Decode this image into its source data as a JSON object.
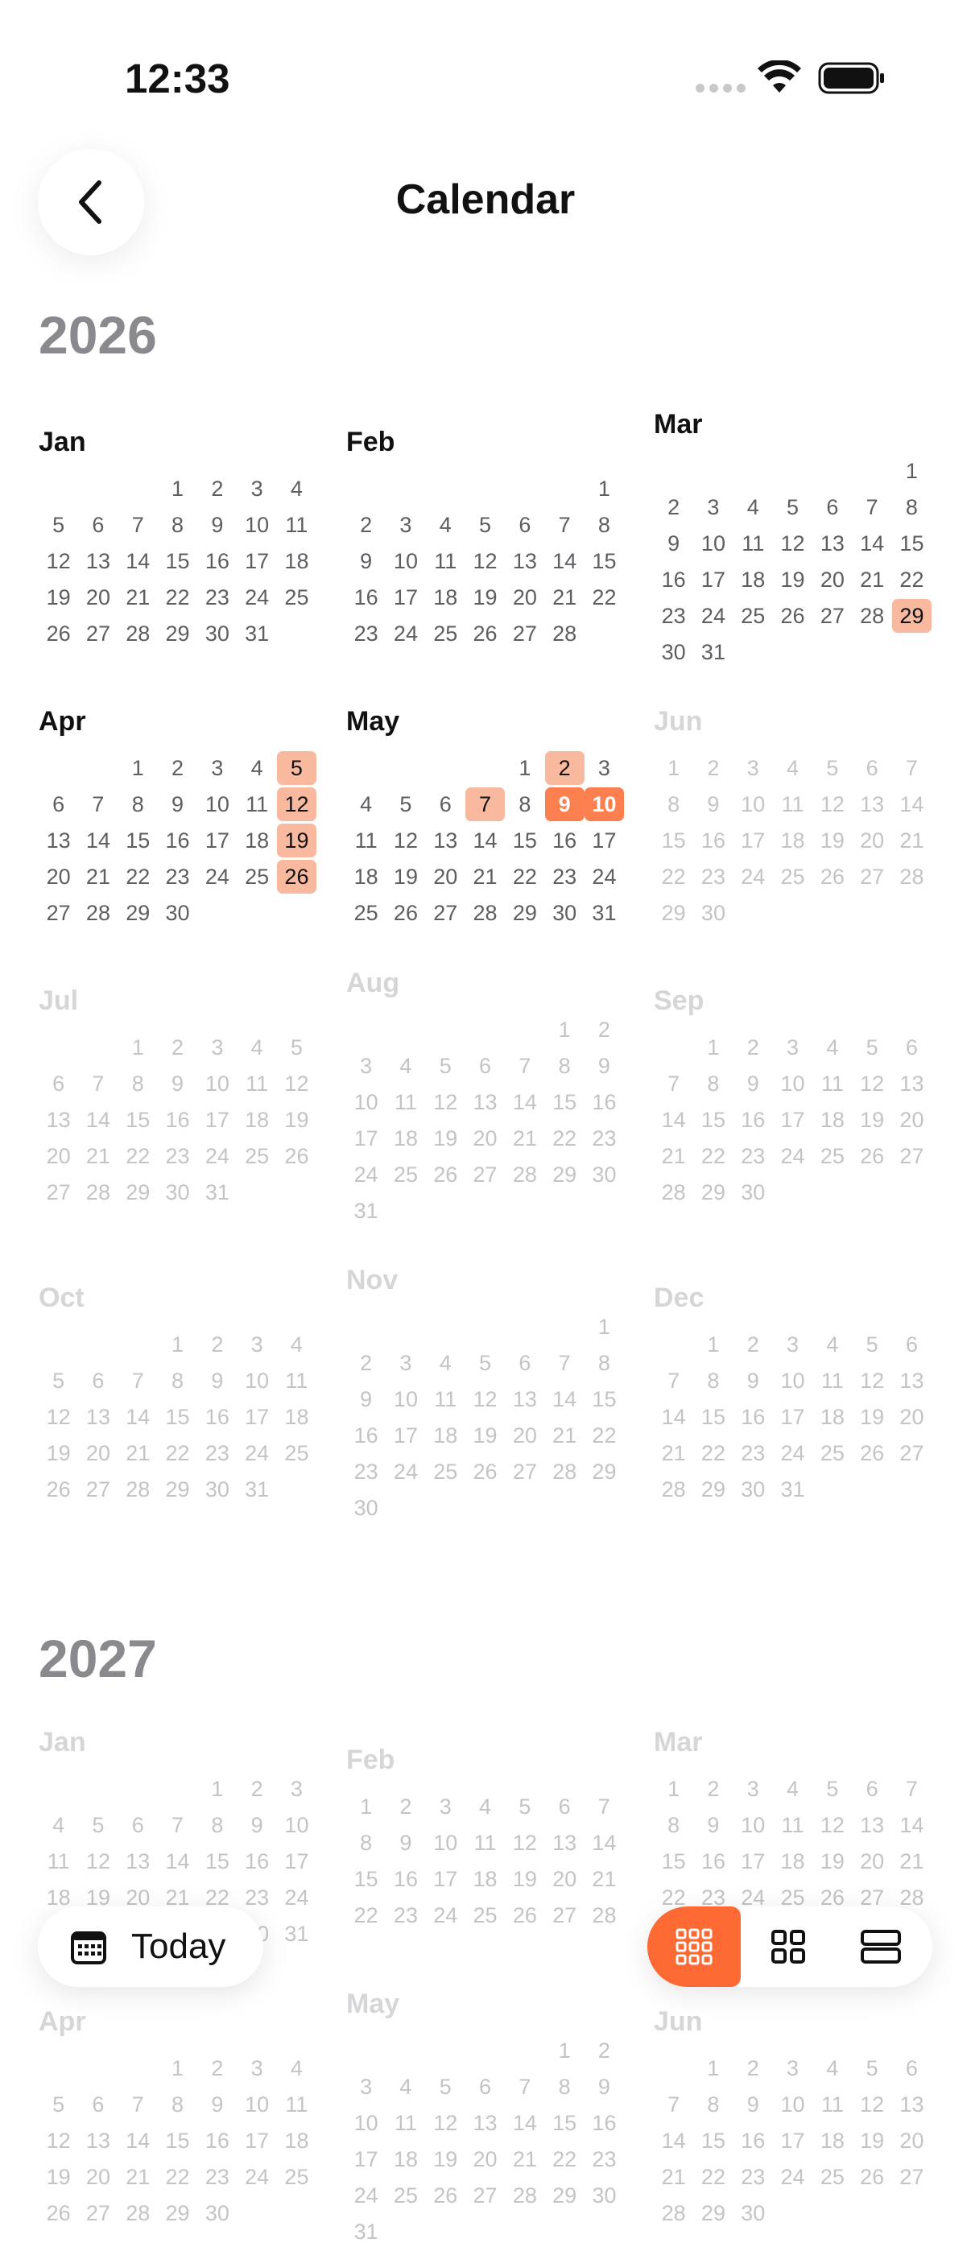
{
  "status_bar": {
    "time": "12:33"
  },
  "header": {
    "title": "Calendar"
  },
  "years": [
    {
      "label": "2026",
      "months": [
        {
          "name": "Jan",
          "start": 3,
          "days": 31,
          "dim": false
        },
        {
          "name": "Feb",
          "start": 6,
          "days": 28,
          "dim": false
        },
        {
          "name": "Mar",
          "start": 6,
          "days": 31,
          "dim": false
        },
        {
          "name": "Apr",
          "start": 2,
          "days": 30,
          "dim": false
        },
        {
          "name": "May",
          "start": 4,
          "days": 31,
          "dim": false
        },
        {
          "name": "Jun",
          "start": 0,
          "days": 30,
          "dim": true
        },
        {
          "name": "Jul",
          "start": 2,
          "days": 31,
          "dim": true
        },
        {
          "name": "Aug",
          "start": 5,
          "days": 31,
          "dim": true
        },
        {
          "name": "Sep",
          "start": 1,
          "days": 30,
          "dim": true
        },
        {
          "name": "Oct",
          "start": 3,
          "days": 31,
          "dim": true
        },
        {
          "name": "Nov",
          "start": 6,
          "days": 30,
          "dim": true
        },
        {
          "name": "Dec",
          "start": 1,
          "days": 31,
          "dim": true
        }
      ]
    },
    {
      "label": "2027",
      "months": [
        {
          "name": "Jan",
          "start": 4,
          "days": 31,
          "dim": true
        },
        {
          "name": "Feb",
          "start": 0,
          "days": 28,
          "dim": true
        },
        {
          "name": "Mar",
          "start": 0,
          "days": 31,
          "dim": true
        },
        {
          "name": "Apr",
          "start": 3,
          "days": 30,
          "dim": true
        },
        {
          "name": "May",
          "start": 5,
          "days": 31,
          "dim": true
        },
        {
          "name": "Jun",
          "start": 1,
          "days": 30,
          "dim": true
        }
      ]
    }
  ],
  "highlights": [
    {
      "year": "2026",
      "month": "Mar",
      "day": 29,
      "level": "light"
    },
    {
      "year": "2026",
      "month": "Apr",
      "day": 5,
      "level": "light"
    },
    {
      "year": "2026",
      "month": "Apr",
      "day": 12,
      "level": "light"
    },
    {
      "year": "2026",
      "month": "Apr",
      "day": 19,
      "level": "light"
    },
    {
      "year": "2026",
      "month": "Apr",
      "day": 26,
      "level": "light"
    },
    {
      "year": "2026",
      "month": "May",
      "day": 2,
      "level": "light"
    },
    {
      "year": "2026",
      "month": "May",
      "day": 7,
      "level": "light"
    },
    {
      "year": "2026",
      "month": "May",
      "day": 9,
      "level": "strong"
    },
    {
      "year": "2026",
      "month": "May",
      "day": 10,
      "level": "strong"
    }
  ],
  "colors": {
    "accent": "#fe6a33",
    "highlight_light": "#f9b99f",
    "highlight_strong": "#fb7f4f"
  },
  "bottom_bar": {
    "today_label": "Today",
    "today_icon": "calendar-icon",
    "view_modes": [
      {
        "name": "year-grid-view",
        "icon": "grid-3x3-icon",
        "active": true
      },
      {
        "name": "quarter-grid-view",
        "icon": "grid-2x2-icon",
        "active": false
      },
      {
        "name": "month-list-view",
        "icon": "rows-icon",
        "active": false
      }
    ]
  }
}
